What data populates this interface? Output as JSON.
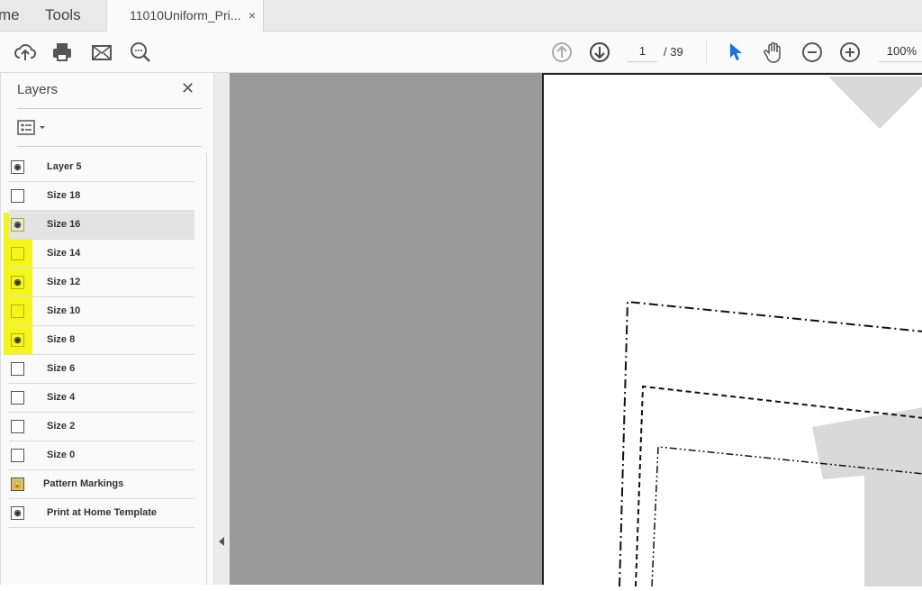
{
  "tabs": {
    "home": "me",
    "tools": "Tools",
    "document": "11010Uniform_Pri...",
    "close": "×"
  },
  "toolbar": {
    "page_current": "1",
    "page_total": "/ 39",
    "zoom": "100%",
    "accent": "#1473e6"
  },
  "layers": {
    "title": "Layers",
    "close": "✕",
    "items": [
      {
        "label": "Layer 5",
        "visible": true
      },
      {
        "label": "Size 18",
        "visible": false
      },
      {
        "label": "Size 16",
        "visible": true,
        "selected": true
      },
      {
        "label": "Size 14",
        "visible": false
      },
      {
        "label": "Size 12",
        "visible": true
      },
      {
        "label": "Size 10",
        "visible": false
      },
      {
        "label": "Size 8",
        "visible": true
      },
      {
        "label": "Size 6",
        "visible": false
      },
      {
        "label": "Size 4",
        "visible": false
      },
      {
        "label": "Size 2",
        "visible": false
      },
      {
        "label": "Size 0",
        "visible": false
      },
      {
        "label": "Pattern Markings",
        "locked": true
      },
      {
        "label": "Print at Home Template",
        "visible": true
      }
    ],
    "highlight_color": "#f4f61a"
  }
}
